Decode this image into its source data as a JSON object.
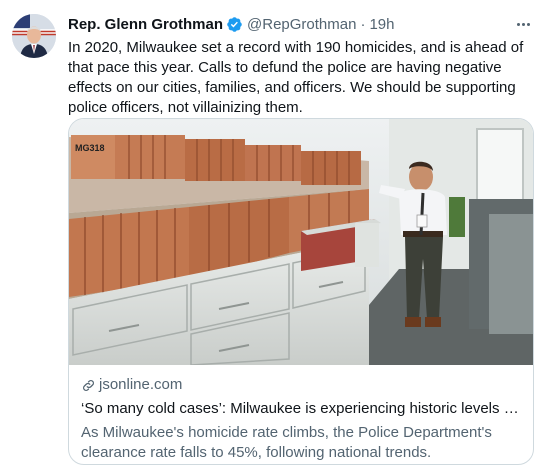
{
  "author": {
    "name": "Rep. Glenn Grothman",
    "handle": "@RepGrothman",
    "separator": "·",
    "time": "19h",
    "avatar_icon": "avatar-portrait-with-flag",
    "verified_icon": "verified-badge-icon",
    "verified_color": "#1d9bf0"
  },
  "tweet": {
    "text": "In 2020, Milwaukee set a record with 190 homicides, and is ahead of that pace this year. Calls to defund the police are having negative effects on our cities, families, and officers. We should be supporting police officers, not villainizing them."
  },
  "card": {
    "image_label": "MG318",
    "domain": "jsonline.com",
    "title": "‘So many cold cases’: Milwaukee is experiencing historic levels of viol...",
    "description": "As Milwaukee's homicide rate climbs, the Police Department's clearance rate falls to 45%, following national trends."
  },
  "colors": {
    "text_primary": "#0f1419",
    "text_secondary": "#536471",
    "border": "#cfd9de",
    "accent": "#1d9bf0"
  }
}
